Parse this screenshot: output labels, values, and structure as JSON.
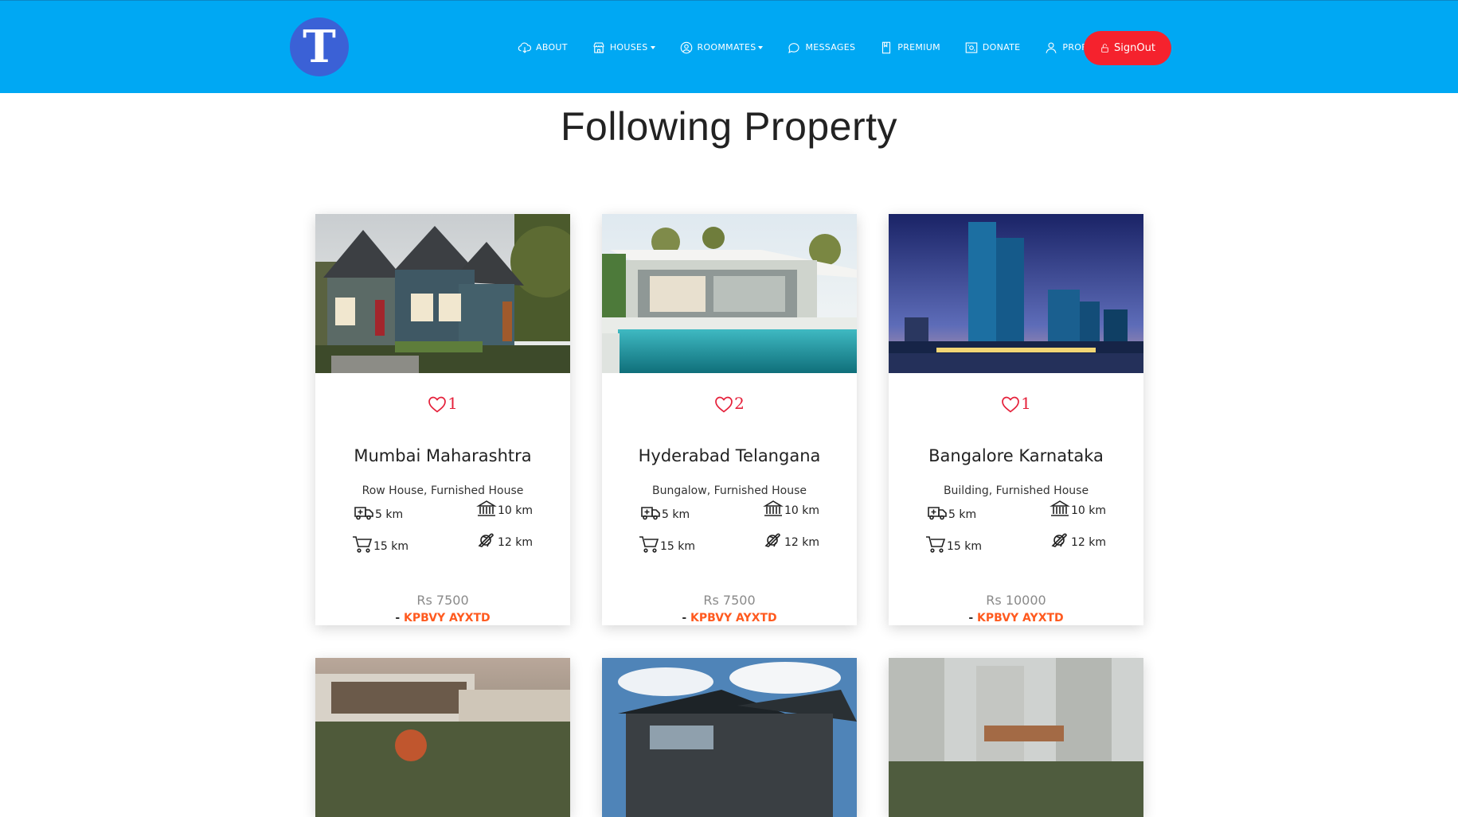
{
  "brand": {
    "logo_letter": "T"
  },
  "nav": {
    "about": "ABOUT",
    "houses": "HOUSES",
    "roommates": "ROOMMATES",
    "messages": "MESSAGES",
    "premium": "PREMIUM",
    "donate": "DONATE",
    "profile": "PROFILE",
    "signout": "SignOut"
  },
  "page": {
    "title": "Following Property"
  },
  "colors": {
    "navbar": "#00a8f3",
    "signout": "#f5222d",
    "heart": "#e5203a",
    "owner": "#ff5a1f",
    "logo": "#3b61d6"
  },
  "cards": [
    {
      "likes": "1",
      "title": "Mumbai Maharashtra",
      "subtitle": "Row House, Furnished House",
      "hospital": "5 km",
      "bank": "10 km",
      "market": "15 km",
      "airport": "12 km",
      "price": "Rs 7500",
      "owner_prefix": "- ",
      "owner": "KPBVY AYXTD"
    },
    {
      "likes": "2",
      "title": "Hyderabad Telangana",
      "subtitle": "Bungalow, Furnished House",
      "hospital": "5 km",
      "bank": "10 km",
      "market": "15 km",
      "airport": "12 km",
      "price": "Rs 7500",
      "owner_prefix": "- ",
      "owner": "KPBVY AYXTD"
    },
    {
      "likes": "1",
      "title": "Bangalore Karnataka",
      "subtitle": "Building, Furnished House",
      "hospital": "5 km",
      "bank": "10 km",
      "market": "15 km",
      "airport": "12 km",
      "price": "Rs 10000",
      "owner_prefix": "- ",
      "owner": "KPBVY AYXTD"
    }
  ]
}
